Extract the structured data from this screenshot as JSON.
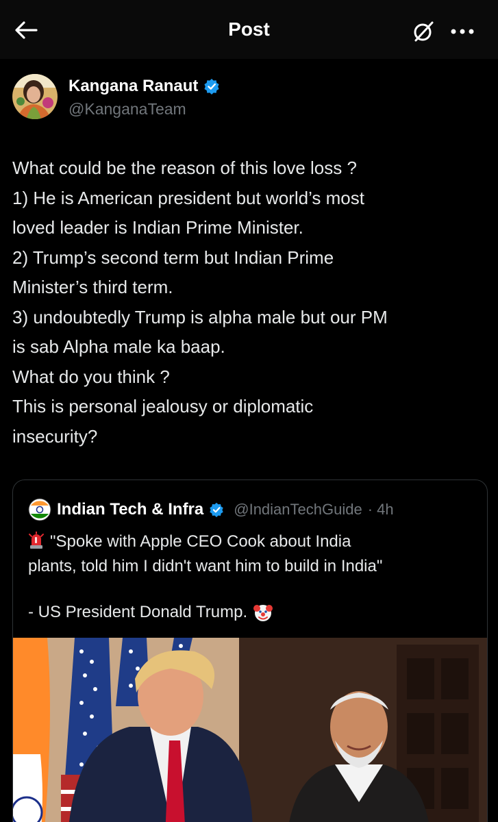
{
  "header": {
    "title": "Post"
  },
  "author": {
    "name": "Kangana Ranaut",
    "handle": "@KanganaTeam"
  },
  "post": {
    "lines": [
      "What could be the reason of this love loss ?",
      "1) He is American president but world’s most",
      "loved leader is Indian Prime Minister.",
      "2) Trump’s second term but Indian Prime",
      "Minister’s third term.",
      "3) undoubtedly Trump is alpha male but our PM",
      "is sab Alpha male ka baap.",
      "What do you think ?",
      "This is personal jealousy or diplomatic",
      "insecurity?"
    ]
  },
  "quote": {
    "name": "Indian Tech & Infra",
    "handle": "@IndianTechGuide",
    "time": "· 4h",
    "text_lines": [
      "\"Spoke with Apple CEO Cook about India",
      "plants, told him I didn't want him to build in India\""
    ],
    "signature": "- US President Donald Trump."
  },
  "colors": {
    "background": "#000000",
    "text": "#e7e9ea",
    "muted": "#71767b",
    "verified": "#1d9bf0",
    "border": "#2f3336"
  },
  "icons": [
    "back-arrow-icon",
    "grok-icon",
    "more-icon",
    "verified-badge-icon",
    "siren-icon",
    "clown-face-icon"
  ]
}
